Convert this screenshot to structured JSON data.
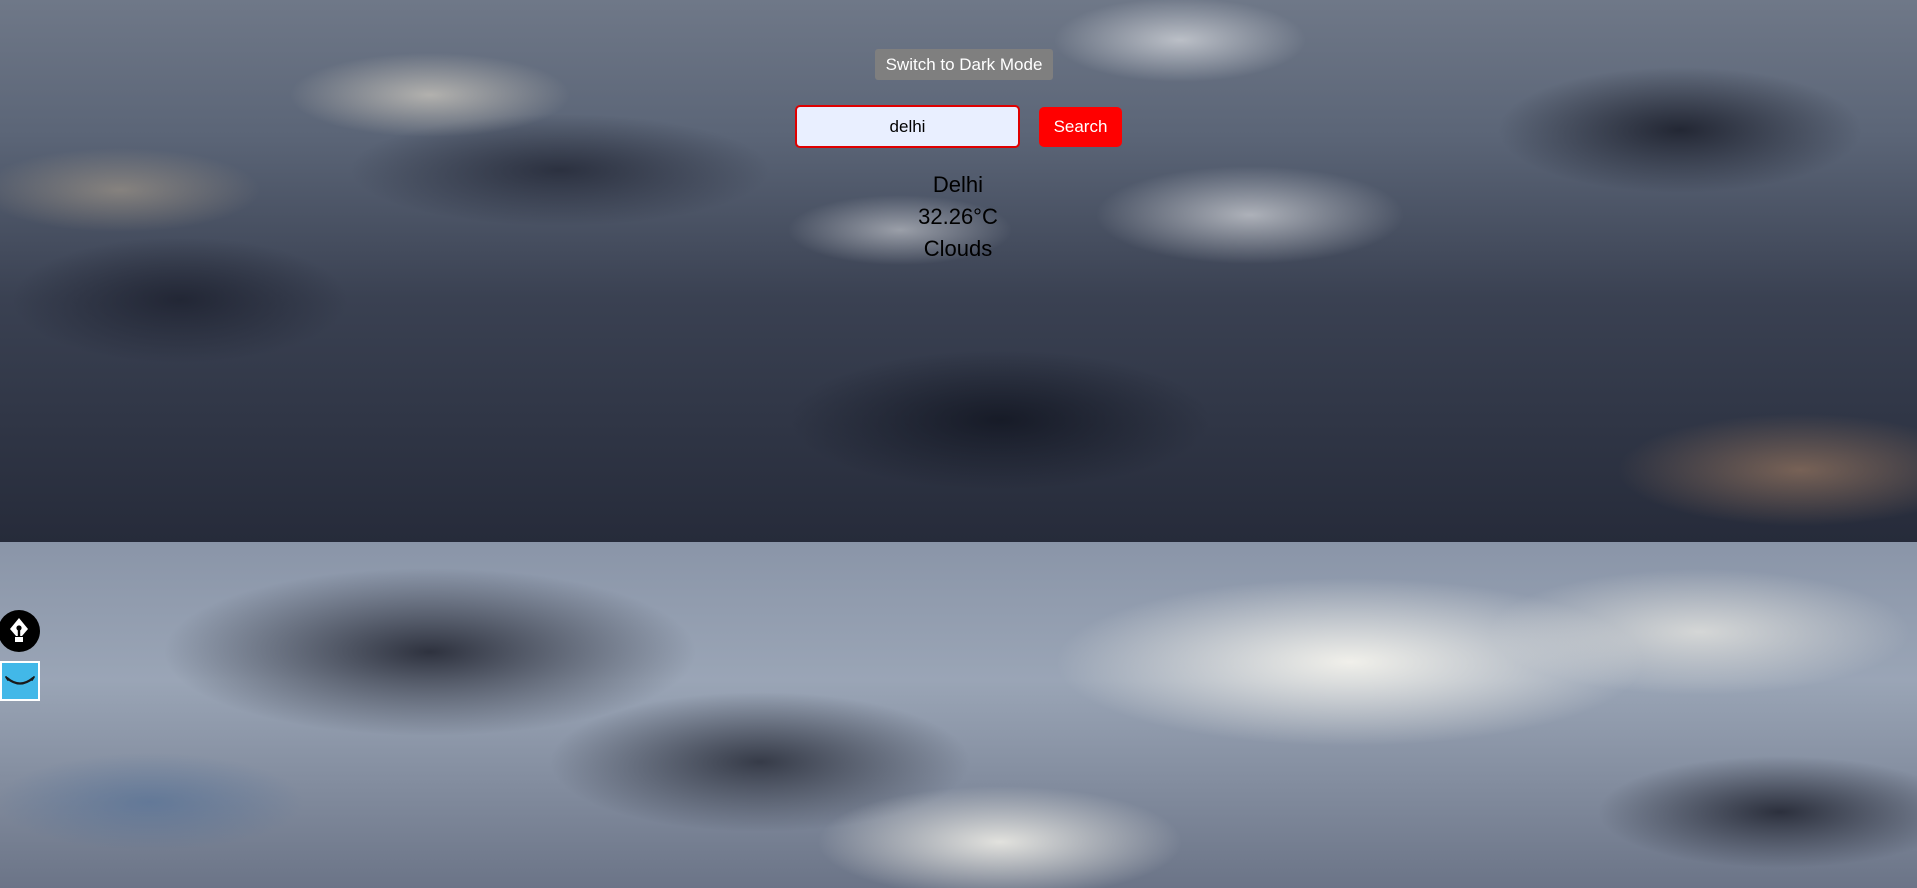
{
  "theme_toggle": {
    "label": "Switch to Dark Mode"
  },
  "search": {
    "value": "delhi",
    "button_label": "Search"
  },
  "weather": {
    "city": "Delhi",
    "temperature": "32.26°C",
    "condition": "Clouds"
  },
  "side_widgets": {
    "pen_icon": "fountain-pen-icon",
    "smile_icon": "smile-icon"
  },
  "colors": {
    "search_button_bg": "#ff0000",
    "input_border": "#e00000",
    "input_bg": "#e9efff",
    "toggle_bg": "#7f7f7f",
    "smile_widget_bg": "#42b8e8"
  }
}
